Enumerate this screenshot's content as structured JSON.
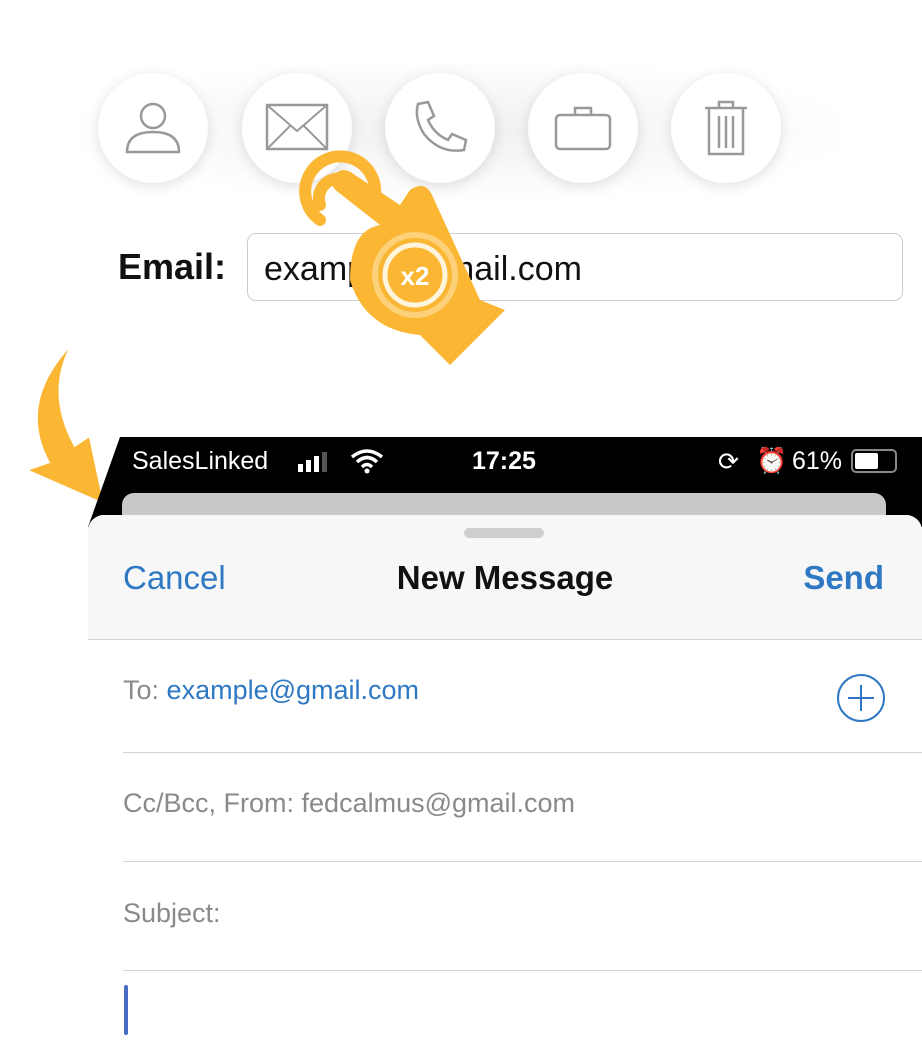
{
  "contact_actions": [
    {
      "icon": "person-icon"
    },
    {
      "icon": "mail-icon"
    },
    {
      "icon": "phone-icon"
    },
    {
      "icon": "briefcase-icon"
    },
    {
      "icon": "trash-icon"
    }
  ],
  "email_field": {
    "label": "Email:",
    "value": "example@gmail.com"
  },
  "gesture": {
    "type": "double-tap",
    "badge": "x2",
    "color": "#fbb634"
  },
  "status_bar": {
    "carrier": "SalesLinked",
    "time": "17:25",
    "battery": "61%"
  },
  "compose": {
    "cancel": "Cancel",
    "title": "New Message",
    "send": "Send",
    "to_label": "To:",
    "to_value": "example@gmail.com",
    "cc_label": "Cc/Bcc, From:",
    "cc_value": "fedcalmus@gmail.com",
    "subject_label": "Subject:"
  },
  "colors": {
    "accent": "#2f78c4",
    "gesture": "#fbb634"
  }
}
